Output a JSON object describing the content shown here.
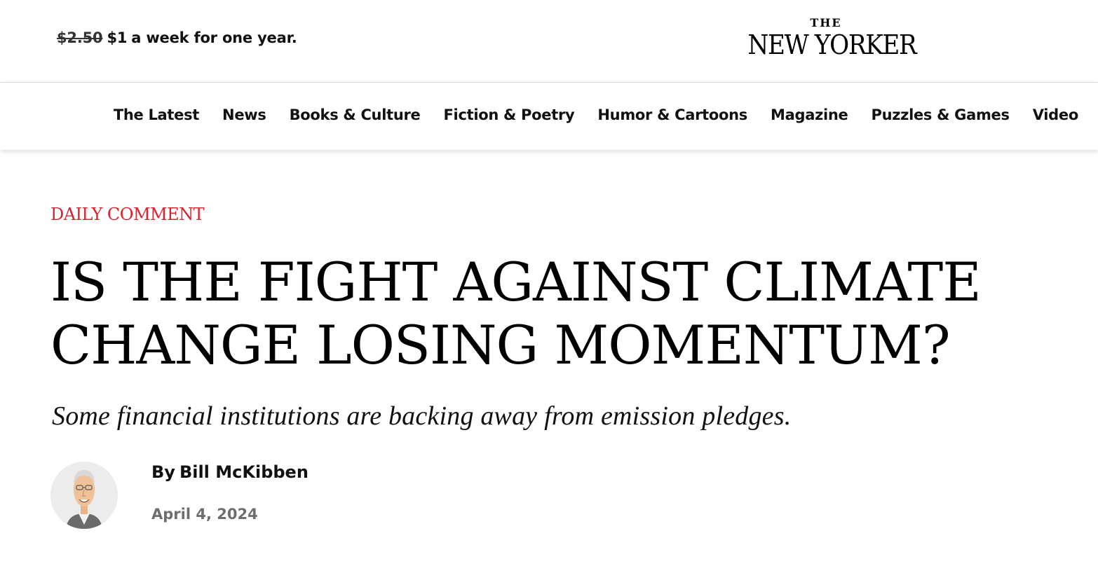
{
  "promo": {
    "old_price": "$2.50",
    "new_price": "$1",
    "text": "a week for one year."
  },
  "logo": {
    "line1": "THE",
    "line2": "NEW YORKER"
  },
  "nav": {
    "items": [
      "The Latest",
      "News",
      "Books & Culture",
      "Fiction & Poetry",
      "Humor & Cartoons",
      "Magazine",
      "Puzzles & Games",
      "Video"
    ]
  },
  "article": {
    "rubric": "DAILY COMMENT",
    "headline_line1": "IS THE FIGHT AGAINST CLIMATE",
    "headline_line2": "CHANGE LOSING MOMENTUM?",
    "dek": "Some financial institutions are backing away from emission pledges.",
    "byline_prefix": "By",
    "author": "Bill McKibben",
    "date": "April 4, 2024"
  },
  "colors": {
    "rubric": "#d9232d",
    "date": "#6e6e6e",
    "divider": "#dcdcdc"
  },
  "icons": {
    "avatar": "author-caricature"
  }
}
